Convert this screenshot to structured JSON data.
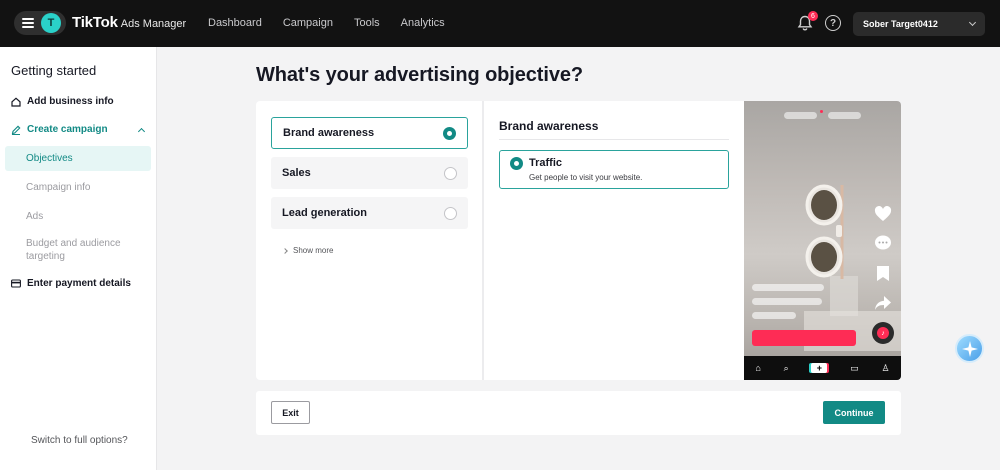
{
  "header": {
    "menu_avatar_letter": "T",
    "brand": "TikTok",
    "brand_sub": "Ads Manager",
    "nav": [
      "Dashboard",
      "Campaign",
      "Tools",
      "Analytics"
    ],
    "notification_count": "6",
    "help_symbol": "?",
    "account_name": "Sober Target0412"
  },
  "sidebar": {
    "title": "Getting started",
    "add_business": "Add business info",
    "create_campaign": "Create campaign",
    "subitems": {
      "objectives": "Objectives",
      "campaign_info": "Campaign info",
      "ads": "Ads",
      "budget": "Budget and audience targeting"
    },
    "payment": "Enter payment details",
    "switch": "Switch to full options?"
  },
  "main": {
    "title": "What's your advertising objective?",
    "objectives": [
      {
        "label": "Brand awareness",
        "selected": true
      },
      {
        "label": "Sales",
        "selected": false
      },
      {
        "label": "Lead generation",
        "selected": false
      }
    ],
    "show_more": "Show more",
    "detail": {
      "title": "Brand awareness",
      "option_title": "Traffic",
      "option_desc": "Get people to visit your website."
    }
  },
  "footer": {
    "exit": "Exit",
    "continue": "Continue"
  },
  "colors": {
    "accent": "#128a85",
    "tiktok_pink": "#fe2c55",
    "tiktok_cyan": "#2ad1c9"
  }
}
